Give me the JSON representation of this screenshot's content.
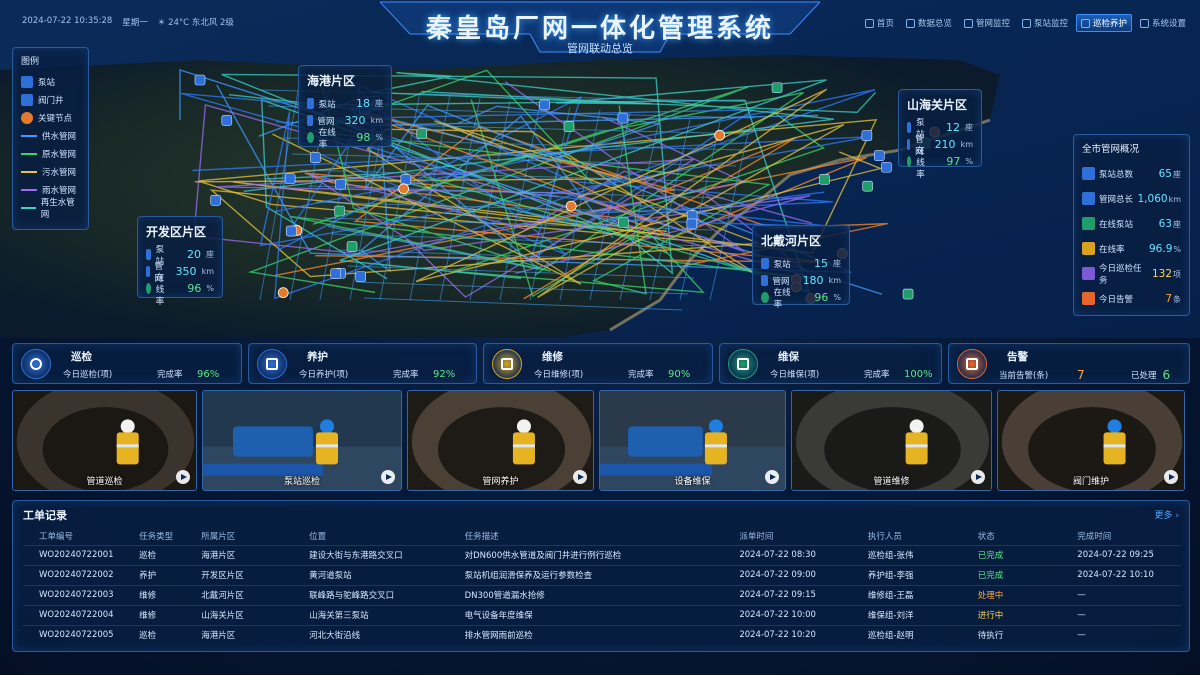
{
  "header": {
    "datetime": "2024-07-22 10:35:28",
    "weekday": "星期一",
    "weather": "☀ 24°C  东北风 2级",
    "title": "秦皇岛厂网一体化管理系统",
    "subtitle": "管网联动总览",
    "nav": [
      {
        "label": "首页",
        "icon": "home-icon",
        "active": false
      },
      {
        "label": "数据总览",
        "icon": "data-icon",
        "active": false
      },
      {
        "label": "管网监控",
        "icon": "monitor-icon",
        "active": false
      },
      {
        "label": "泵站监控",
        "icon": "pump-icon",
        "active": false
      },
      {
        "label": "巡检养护",
        "icon": "inspect-icon",
        "active": true
      },
      {
        "label": "系统设置",
        "icon": "gear-icon",
        "active": false
      }
    ]
  },
  "legend": {
    "title": "图例",
    "items": [
      {
        "label": "泵站",
        "icon": "pump-station-icon",
        "color": "#2f6fd8"
      },
      {
        "label": "阀门井",
        "icon": "valve-icon",
        "color": "#2f6fd8"
      },
      {
        "label": "关键节点",
        "icon": "key-node-icon",
        "color": "#e57a2a"
      },
      {
        "label": "供水管网",
        "color": "#3f9bff"
      },
      {
        "label": "原水管网",
        "color": "#3ad66b"
      },
      {
        "label": "污水管网",
        "color": "#e8c43a"
      },
      {
        "label": "雨水管网",
        "color": "#9a6cf2"
      },
      {
        "label": "再生水管网",
        "color": "#39d2c8"
      }
    ]
  },
  "regions": [
    {
      "name": "海港片区",
      "pump": "18",
      "pump_unit": "座",
      "pipe": "320",
      "pipe_unit": "km",
      "online": "98",
      "online_unit": "%"
    },
    {
      "name": "山海关片区",
      "pump": "12",
      "pump_unit": "座",
      "pipe": "210",
      "pipe_unit": "km",
      "online": "97",
      "online_unit": "%"
    },
    {
      "name": "开发区片区",
      "pump": "20",
      "pump_unit": "座",
      "pipe": "350",
      "pipe_unit": "km",
      "online": "96",
      "online_unit": "%"
    },
    {
      "name": "北戴河片区",
      "pump": "15",
      "pump_unit": "座",
      "pipe": "180",
      "pipe_unit": "km",
      "online": "96",
      "online_unit": "%"
    }
  ],
  "region_labels": {
    "pump": "泵站",
    "pipe": "管网",
    "online": "在线率"
  },
  "overview": {
    "title": "全市管网概况",
    "rows": [
      {
        "label": "泵站总数",
        "value": "65",
        "unit": "座",
        "color": "#2f6fd8"
      },
      {
        "label": "管网总长",
        "value": "1,060",
        "unit": "km",
        "color": "#2f6fd8"
      },
      {
        "label": "在线泵站",
        "value": "63",
        "unit": "座",
        "color": "#1f9d6a"
      },
      {
        "label": "在线率",
        "value": "96.9",
        "unit": "%",
        "color": "#d9a21f"
      },
      {
        "label": "今日巡检任务",
        "value": "132",
        "unit": "项",
        "color": "#7a5ad8"
      },
      {
        "label": "今日告警",
        "value": "7",
        "unit": "条",
        "color": "#e5662a"
      }
    ]
  },
  "kpis": [
    {
      "name": "巡检",
      "sub": "今日巡检(项)",
      "rate_label": "完成率",
      "rate": "96%",
      "icon": "search-icon"
    },
    {
      "name": "养护",
      "sub": "今日养护(项)",
      "rate_label": "完成率",
      "rate": "92%",
      "icon": "tools-icon"
    },
    {
      "name": "维修",
      "sub": "今日维修(项)",
      "rate_label": "完成率",
      "rate": "90%",
      "icon": "wrench-icon"
    },
    {
      "name": "维保",
      "sub": "今日维保(项)",
      "rate_label": "完成率",
      "rate": "100%",
      "icon": "shield-icon"
    },
    {
      "name": "告警",
      "sub": "当前告警(条)",
      "count": "7",
      "handled_label": "已处理",
      "handled": "6",
      "icon": "alarm-icon"
    }
  ],
  "photos": [
    {
      "label": "管道巡检"
    },
    {
      "label": "泵站巡检"
    },
    {
      "label": "管网养护"
    },
    {
      "label": "设备维保"
    },
    {
      "label": "管道维修"
    },
    {
      "label": "阀门维护"
    }
  ],
  "orders": {
    "title": "工单记录",
    "more": "更多",
    "columns": [
      "工单编号",
      "任务类型",
      "所属片区",
      "位置",
      "任务描述",
      "派单时间",
      "执行人员",
      "状态",
      "完成时间"
    ],
    "rows": [
      [
        "WO20240722001",
        "巡检",
        "海港片区",
        "建设大街与东港路交叉口",
        "对DN600供水管道及阀门井进行例行巡检",
        "2024-07-22 08:30",
        "巡检组-张伟",
        "已完成",
        "2024-07-22 09:25"
      ],
      [
        "WO20240722002",
        "养护",
        "开发区片区",
        "黄河道泵站",
        "泵站机组润滑保养及运行参数检查",
        "2024-07-22 09:00",
        "养护组-李强",
        "已完成",
        "2024-07-22 10:10"
      ],
      [
        "WO20240722003",
        "维修",
        "北戴河片区",
        "联峰路与驼峰路交叉口",
        "DN300管道漏水抢修",
        "2024-07-22 09:15",
        "维修组-王磊",
        "处理中",
        "—"
      ],
      [
        "WO20240722004",
        "维修",
        "山海关片区",
        "山海关第三泵站",
        "电气设备年度维保",
        "2024-07-22 10:00",
        "维保组-刘洋",
        "进行中",
        "—"
      ],
      [
        "WO20240722005",
        "巡检",
        "海港片区",
        "河北大街沿线",
        "排水管网雨前巡检",
        "2024-07-22 10:20",
        "巡检组-赵明",
        "待执行",
        "—"
      ]
    ]
  }
}
